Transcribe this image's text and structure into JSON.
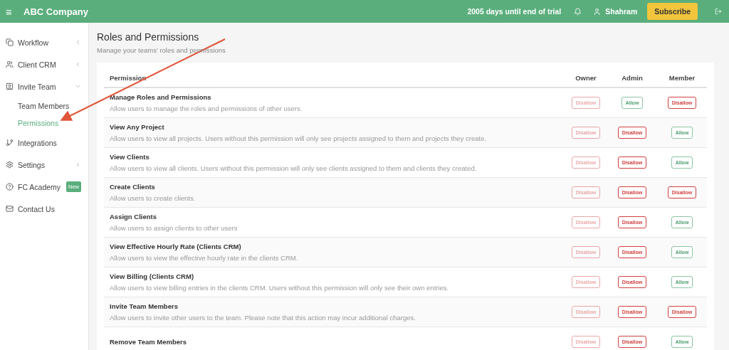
{
  "topbar": {
    "menu_icon": "≡",
    "company": "ABC Company",
    "trial": "2005 days until end of trial",
    "user": "Shahram",
    "subscribe": "Subscribe"
  },
  "sidebar": {
    "items": [
      {
        "label": "Workflow",
        "expanded": false
      },
      {
        "label": "Client CRM",
        "expanded": false
      },
      {
        "label": "Invite Team",
        "expanded": true,
        "children": [
          {
            "label": "Team Members",
            "selected": false
          },
          {
            "label": "Permissions",
            "selected": true
          }
        ]
      },
      {
        "label": "Integrations"
      },
      {
        "label": "Settings",
        "expanded": false
      },
      {
        "label": "FC Academy",
        "badge": "New"
      },
      {
        "label": "Contact Us"
      }
    ]
  },
  "page": {
    "title": "Roles and Permissions",
    "subtitle": "Manage your teams' roles and permissions"
  },
  "table": {
    "columns": [
      "Permission",
      "Owner",
      "Admin",
      "Member"
    ],
    "rows": [
      {
        "cells": [
          {
            "kind": "permission",
            "name": "Manage Roles and Permissions",
            "description": "Allow users to manage the roles and permissions of other users."
          },
          {
            "label": "Disallow",
            "kind": "disallow",
            "disabled": true
          },
          {
            "label": "Allow",
            "kind": "allow",
            "disabled": false
          },
          {
            "label": "Disallow",
            "kind": "disallow",
            "disabled": false
          }
        ]
      },
      {
        "cells": [
          {
            "kind": "permission",
            "name": "View Any Project",
            "description": "Allow users to view all projects. Users without this permission will only see projects assigned to them and projects they create."
          },
          {
            "label": "Disallow",
            "kind": "disallow",
            "disabled": true
          },
          {
            "label": "Disallow",
            "kind": "disallow",
            "disabled": false
          },
          {
            "label": "Allow",
            "kind": "allow",
            "disabled": false
          }
        ]
      },
      {
        "cells": [
          {
            "kind": "permission",
            "name": "View Clients",
            "description": "Allow users to view all clients. Users without this permission will only see clients assigned to them and clients they created."
          },
          {
            "label": "Disallow",
            "kind": "disallow",
            "disabled": true
          },
          {
            "label": "Disallow",
            "kind": "disallow",
            "disabled": false
          },
          {
            "label": "Allow",
            "kind": "allow",
            "disabled": false
          }
        ]
      },
      {
        "cells": [
          {
            "kind": "permission",
            "name": "Create Clients",
            "description": "Allow users to create clients."
          },
          {
            "label": "Disallow",
            "kind": "disallow",
            "disabled": true
          },
          {
            "label": "Disallow",
            "kind": "disallow",
            "disabled": false
          },
          {
            "label": "Disallow",
            "kind": "disallow",
            "disabled": false
          }
        ]
      },
      {
        "cells": [
          {
            "kind": "permission",
            "name": "Assign Clients",
            "description": "Allow users to assign clients to other users"
          },
          {
            "label": "Disallow",
            "kind": "disallow",
            "disabled": true
          },
          {
            "label": "Disallow",
            "kind": "disallow",
            "disabled": false
          },
          {
            "label": "Allow",
            "kind": "allow",
            "disabled": false
          }
        ]
      },
      {
        "cells": [
          {
            "kind": "permission",
            "name": "View Effective Hourly Rate (Clients CRM)",
            "description": "Allow users to view the effective hourly rate in the clients CRM."
          },
          {
            "label": "Disallow",
            "kind": "disallow",
            "disabled": true
          },
          {
            "label": "Disallow",
            "kind": "disallow",
            "disabled": false
          },
          {
            "label": "Allow",
            "kind": "allow",
            "disabled": false
          }
        ]
      },
      {
        "cells": [
          {
            "kind": "permission",
            "name": "View Billing (Clients CRM)",
            "description": "Allow users to view billing entries in the clients CRM. Users without this permission will only see their own entries."
          },
          {
            "label": "Disallow",
            "kind": "disallow",
            "disabled": true
          },
          {
            "label": "Disallow",
            "kind": "disallow",
            "disabled": false
          },
          {
            "label": "Allow",
            "kind": "allow",
            "disabled": false
          }
        ]
      },
      {
        "cells": [
          {
            "kind": "permission",
            "name": "Invite Team Members",
            "description": "Allow users to invite other users to the team. Please note that this action may incur additional charges."
          },
          {
            "label": "Disallow",
            "kind": "disallow",
            "disabled": true
          },
          {
            "label": "Disallow",
            "kind": "disallow",
            "disabled": false
          },
          {
            "label": "Disallow",
            "kind": "disallow",
            "disabled": false
          }
        ]
      },
      {
        "cells": [
          {
            "kind": "permission",
            "name": "Remove Team Members"
          },
          {
            "label": "Disallow",
            "kind": "disallow",
            "disabled": true
          },
          {
            "label": "Disallow",
            "kind": "disallow",
            "disabled": false
          },
          {
            "label": "Allow",
            "kind": "allow",
            "disabled": false
          }
        ]
      }
    ]
  }
}
